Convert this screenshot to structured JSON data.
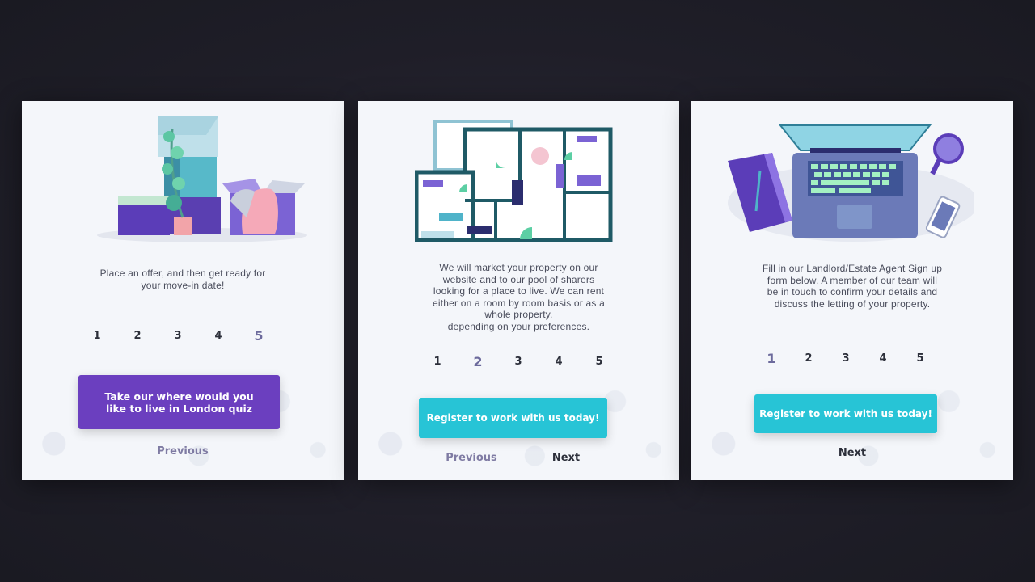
{
  "cards": [
    {
      "illustration": "moving-boxes",
      "description": "Place an offer, and then get ready for\nyour move-in date!",
      "steps": [
        "1",
        "2",
        "3",
        "4",
        "5"
      ],
      "active_step": "5",
      "button_label": "Take our where would you like to live in London quiz",
      "button_color": "#6b3fbf",
      "previous_label": "Previous"
    },
    {
      "illustration": "floor-plan",
      "description": "We will market your property on our\nwebsite and to our pool of sharers\nlooking for a place to live. We can rent\neither on a room by room basis or as a\nwhole property,\ndepending on your preferences.",
      "steps": [
        "1",
        "2",
        "3",
        "4",
        "5"
      ],
      "active_step": "2",
      "button_label": "Register to work with us today!",
      "button_color": "#27c4d6",
      "previous_label": "Previous",
      "next_label": "Next"
    },
    {
      "illustration": "laptop-desk",
      "description": "Fill in our Landlord/Estate Agent Sign up\nform below. A member of our team will\nbe in touch to confirm your details and\ndiscuss the letting of your property.",
      "steps": [
        "1",
        "2",
        "3",
        "4",
        "5"
      ],
      "active_step": "1",
      "button_label": "Register to work with us today!",
      "button_color": "#27c4d6",
      "next_label": "Next"
    }
  ]
}
